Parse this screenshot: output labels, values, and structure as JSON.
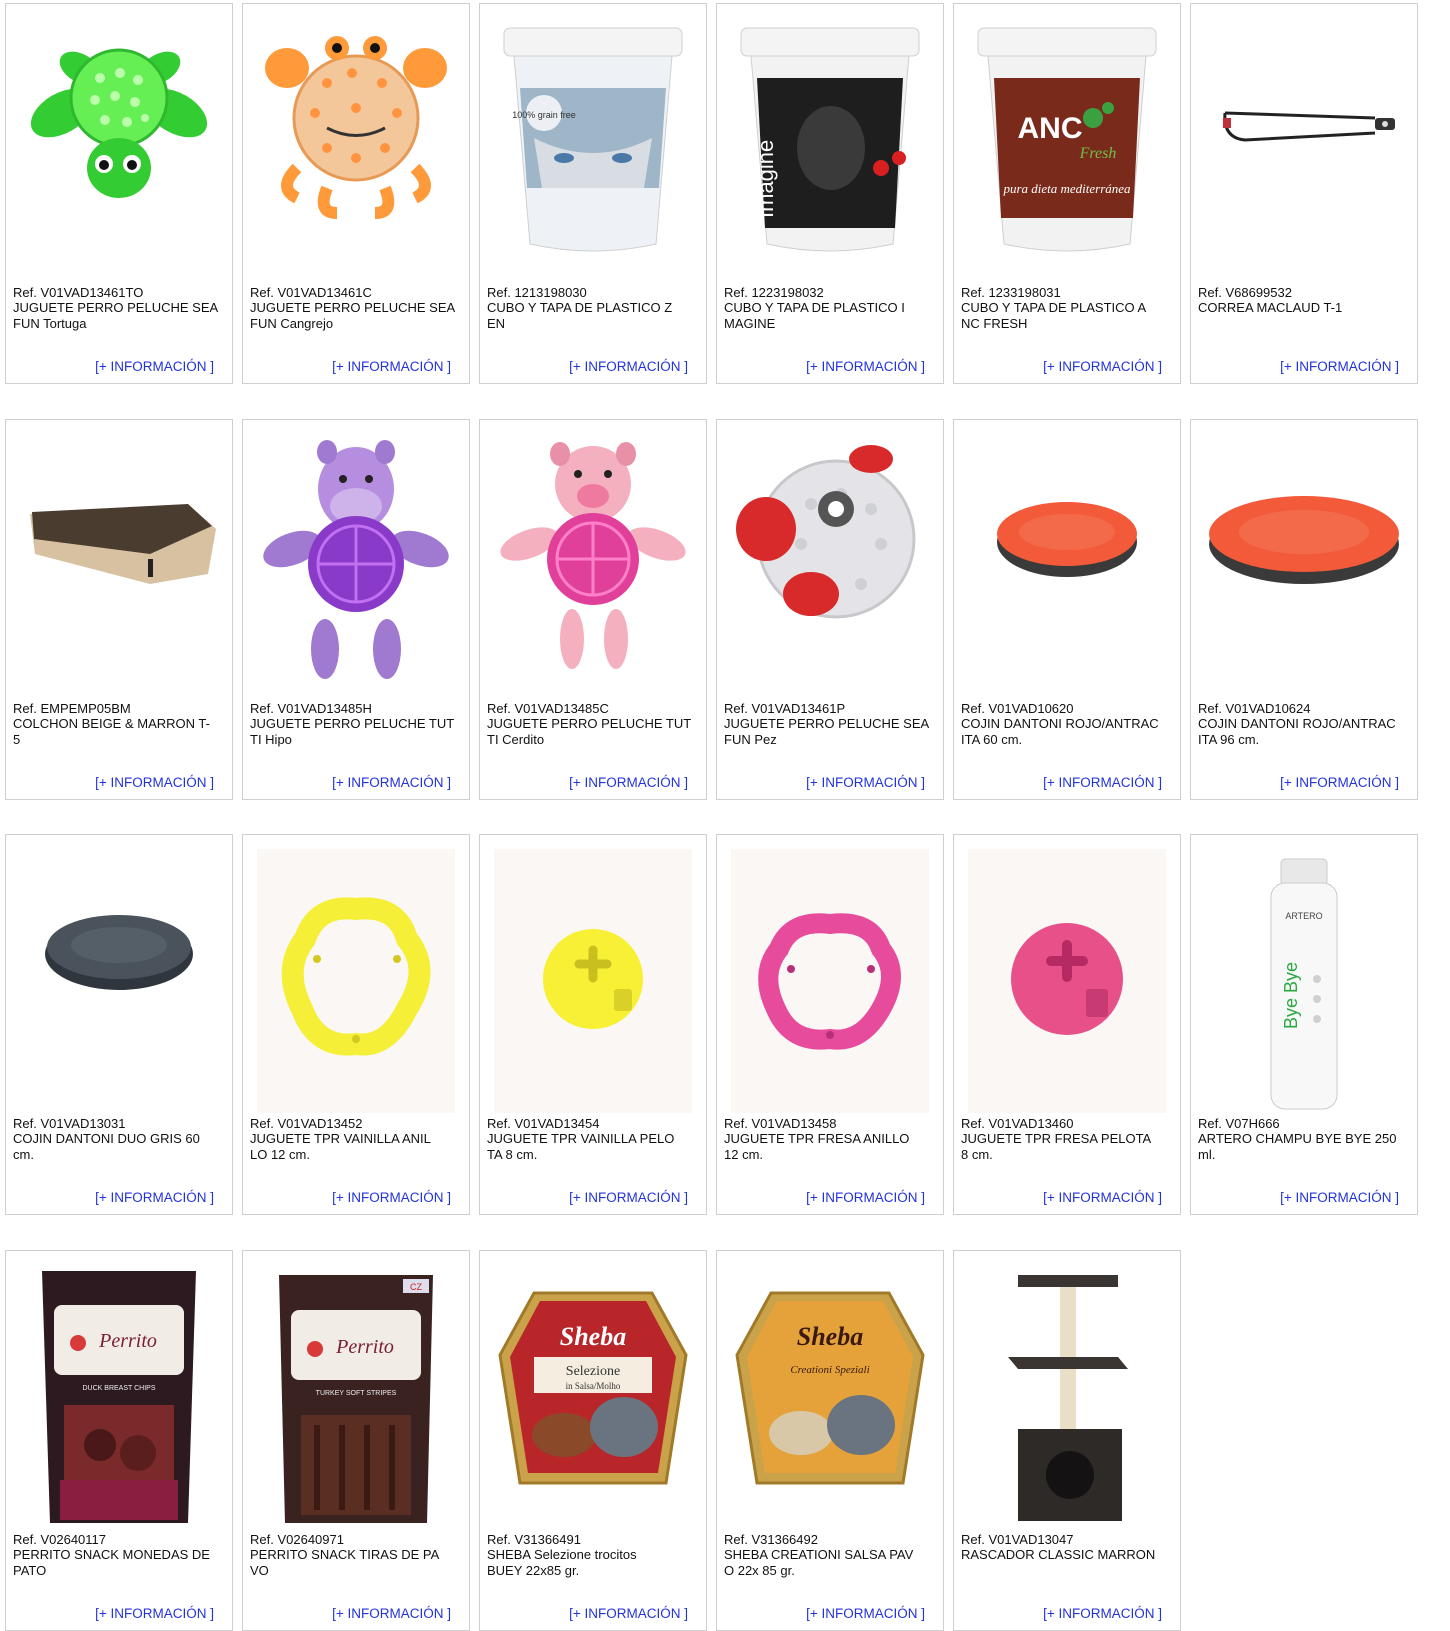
{
  "info_label": "[+ INFORMACIÓN ]",
  "products": [
    {
      "ref": "Ref. V01VAD13461TO",
      "name": "JUGUETE PERRO PELUCHE SEA FUN Tortuga",
      "icon": "green-turtle-toy-image"
    },
    {
      "ref": "Ref. V01VAD13461C",
      "name": "JUGUETE PERRO PELUCHE SEA FUN Cangrejo",
      "icon": "orange-crab-toy-image"
    },
    {
      "ref": "Ref. 1213198030",
      "name": "CUBO Y TAPA DE PLASTICO Z\nEN",
      "icon": "husky-bucket-image"
    },
    {
      "ref": "Ref. 1223198032",
      "name": "CUBO Y TAPA DE PLASTICO I\nMAGINE",
      "icon": "imagine-bucket-image"
    },
    {
      "ref": "Ref. 1233198031",
      "name": "CUBO Y TAPA DE PLASTICO A\nNC FRESH",
      "icon": "anc-fresh-bucket-image"
    },
    {
      "ref": "Ref. V68699532",
      "name": "CORREA MACLAUD T-1",
      "icon": "leash-image"
    },
    {
      "ref": "Ref. EMPEMP05BM",
      "name": "COLCHON BEIGE & MARRON T-\n5",
      "icon": "mattress-image"
    },
    {
      "ref": "Ref. V01VAD13485H",
      "name": "JUGUETE PERRO PELUCHE TUT\nTI Hipo",
      "icon": "purple-hippo-toy-image"
    },
    {
      "ref": "Ref. V01VAD13485C",
      "name": "JUGUETE PERRO PELUCHE TUT\nTI Cerdito",
      "icon": "pink-pig-toy-image"
    },
    {
      "ref": "Ref. V01VAD13461P",
      "name": "JUGUETE PERRO PELUCHE SEA FUN Pez",
      "icon": "red-fish-toy-image"
    },
    {
      "ref": "Ref. V01VAD10620",
      "name": "COJIN DANTONI ROJO/ANTRAC\nITA 60 cm.",
      "icon": "red-cushion-small-image"
    },
    {
      "ref": "Ref. V01VAD10624",
      "name": "COJIN DANTONI ROJO/ANTRAC\nITA 96 cm.",
      "icon": "red-cushion-large-image"
    },
    {
      "ref": "Ref. V01VAD13031",
      "name": "COJIN DANTONI DUO GRIS 60\n cm.",
      "icon": "grey-cushion-image"
    },
    {
      "ref": "Ref. V01VAD13452",
      "name": "JUGUETE TPR VAINILLA ANIL\nLO  12 cm.",
      "icon": "yellow-ring-toy-image"
    },
    {
      "ref": "Ref. V01VAD13454",
      "name": "JUGUETE TPR VAINILLA PELO\nTA  8 cm.",
      "icon": "yellow-ball-toy-image"
    },
    {
      "ref": "Ref. V01VAD13458",
      "name": "JUGUETE TPR FRESA ANILLO\n 12 cm.",
      "icon": "pink-ring-toy-image"
    },
    {
      "ref": "Ref. V01VAD13460",
      "name": "JUGUETE TPR FRESA PELOTA\n8 cm.",
      "icon": "pink-ball-toy-image"
    },
    {
      "ref": "Ref. V07H666",
      "name": "ARTERO CHAMPU BYE BYE 250\n ml.",
      "icon": "shampoo-bottle-image"
    },
    {
      "ref": "Ref. V02640117",
      "name": "PERRITO SNACK MONEDAS DE\nPATO",
      "icon": "perrito-duck-snack-image"
    },
    {
      "ref": "Ref. V02640971",
      "name": "PERRITO SNACK TIRAS DE PA\nVO",
      "icon": "perrito-turkey-snack-image"
    },
    {
      "ref": "Ref. V31366491",
      "name": "SHEBA Selezione trocitos\nBUEY 22x85 gr.",
      "icon": "sheba-selezione-tray-image"
    },
    {
      "ref": "Ref. V31366492",
      "name": "SHEBA CREATIONI SALSA PAV\nO 22x 85 gr.",
      "icon": "sheba-creationi-tray-image"
    },
    {
      "ref": "Ref. V01VAD13047",
      "name": "RASCADOR CLASSIC MARRON",
      "icon": "cat-scratcher-image"
    }
  ],
  "image_text": {
    "grain_free": "100% grain free",
    "imagine": "Imagine",
    "anc": "ANC",
    "fresh": "Fresh",
    "pura_dieta": "pura dieta mediterránea",
    "artero": "ARTERO",
    "bye_bye": "Bye Bye",
    "perrito": "Perrito",
    "duck_chips": "DUCK BREAST CHIPS",
    "turkey_stripes": "TURKEY SOFT STRIPES",
    "cz": "CZ",
    "sheba": "Sheba",
    "selezione": "Selezione",
    "in_salsa": "in Salsa/Molho",
    "creationi": "Creationi Speziali"
  }
}
